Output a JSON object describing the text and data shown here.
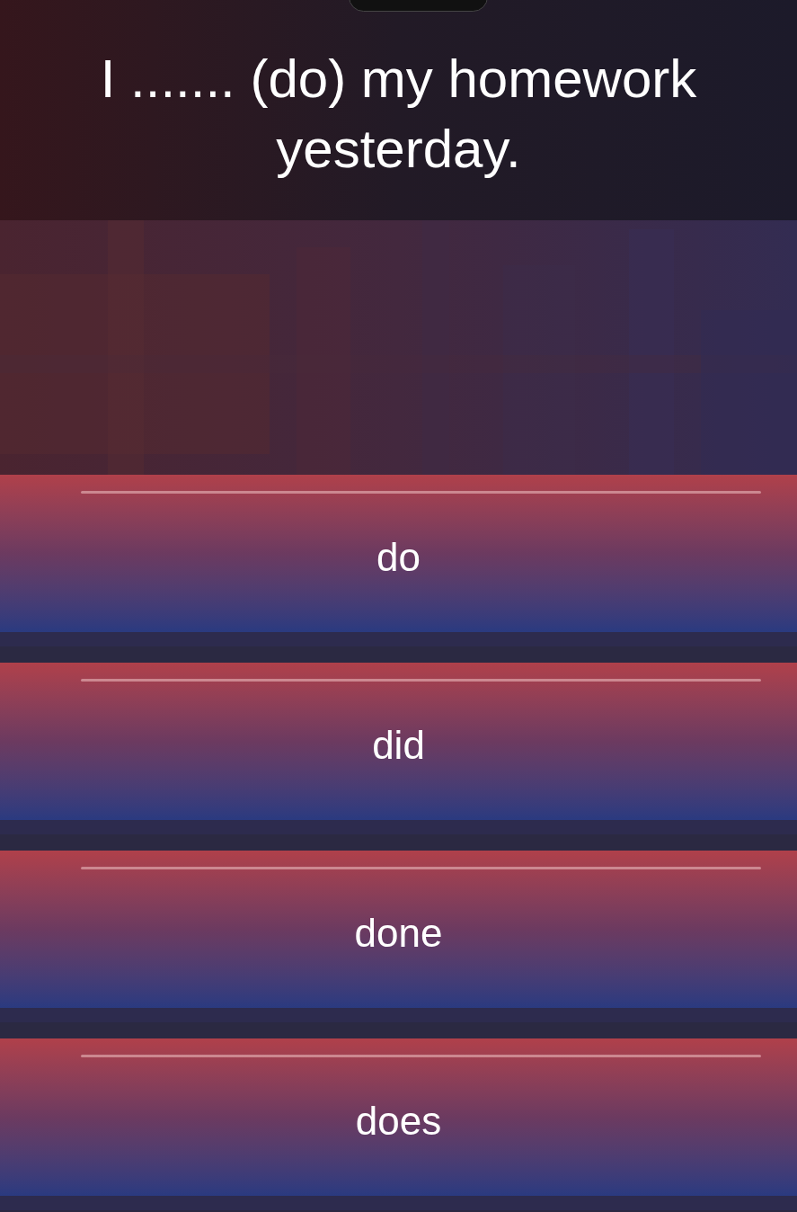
{
  "question": {
    "text": "I ....... (do) my homework yesterday."
  },
  "options": [
    {
      "label": "do"
    },
    {
      "label": "did"
    },
    {
      "label": "done"
    },
    {
      "label": "does"
    }
  ]
}
